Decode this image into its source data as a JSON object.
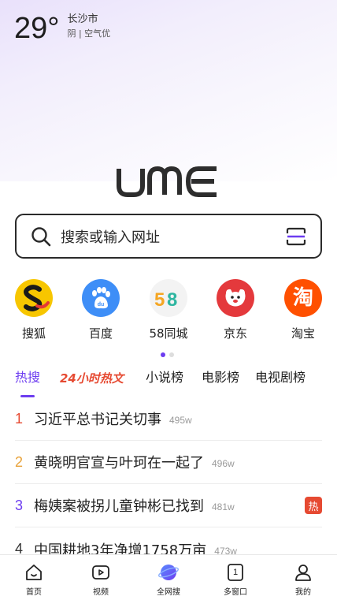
{
  "weather": {
    "temperature": "29°",
    "city": "长沙市",
    "condition": "阴 | 空气优"
  },
  "logo_text": "UME",
  "search": {
    "placeholder": "搜索或输入网址"
  },
  "shortcuts": [
    {
      "label": "搜狐",
      "icon": "sohu-icon",
      "color": "#f7c600"
    },
    {
      "label": "百度",
      "icon": "baidu-icon",
      "color": "#3e8ef7"
    },
    {
      "label": "58同城",
      "icon": "58-icon",
      "color": "#f1f1f1"
    },
    {
      "label": "京东",
      "icon": "jd-icon",
      "color": "#e4393c"
    },
    {
      "label": "淘宝",
      "icon": "taobao-icon",
      "color": "#ff5000"
    }
  ],
  "pager": {
    "pages": 2,
    "active": 1
  },
  "tabs": [
    {
      "label": "热搜",
      "active": true
    },
    {
      "label": "24小时热文",
      "active": false
    },
    {
      "label": "小说榜",
      "active": false
    },
    {
      "label": "电影榜",
      "active": false
    },
    {
      "label": "电视剧榜",
      "active": false
    }
  ],
  "hot_list": [
    {
      "rank": "1",
      "title": "习近平总书记关切事",
      "count": "495w",
      "rank_color": "#e64a32",
      "badge": ""
    },
    {
      "rank": "2",
      "title": "黄晓明官宣与叶珂在一起了",
      "count": "496w",
      "rank_color": "#e8a23a",
      "badge": ""
    },
    {
      "rank": "3",
      "title": "梅姨案被拐儿童钟彬已找到",
      "count": "481w",
      "rank_color": "#6d3df0",
      "badge": "热"
    },
    {
      "rank": "4",
      "title": "中国耕地3年净增1758万亩",
      "count": "473w",
      "rank_color": "#333333",
      "badge": ""
    }
  ],
  "bottom_nav": [
    {
      "label": "首页",
      "icon": "home-icon"
    },
    {
      "label": "视频",
      "icon": "video-icon"
    },
    {
      "label": "全网搜",
      "icon": "planet-icon"
    },
    {
      "label": "多窗口",
      "icon": "windows-icon",
      "count": "1"
    },
    {
      "label": "我的",
      "icon": "profile-icon"
    }
  ],
  "colors": {
    "accent": "#6d3df0",
    "hot": "#e64a32"
  }
}
